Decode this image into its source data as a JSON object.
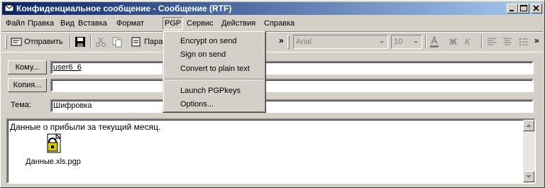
{
  "window": {
    "title": "Конфиденциальное сообщение - Сообщение (RTF)"
  },
  "menubar": {
    "items": [
      "Файл",
      "Правка",
      "Вид",
      "Вставка",
      "Формат",
      "PGP",
      "Сервис",
      "Действия",
      "Справка"
    ],
    "open_item": "PGP"
  },
  "pgp_menu": {
    "items": [
      "Encrypt on send",
      "Sign on send",
      "Convert to plain text",
      "Launch PGPkeys",
      "Options..."
    ]
  },
  "toolbar": {
    "send_label": "Отправить",
    "params_label": "Пара",
    "font_name": "Arial",
    "font_size": "10",
    "bold_label": "Ж",
    "italic_label": "К"
  },
  "fields": {
    "to_button": "Кому...",
    "to_value": "user6_6",
    "cc_button": "Копия...",
    "cc_value": "",
    "subject_label": "Тема:",
    "subject_value": "Шифровка"
  },
  "message": {
    "body": "Данные о прибыли за текущий месяц.",
    "attachment_name": "Данные.xls.pgp"
  }
}
